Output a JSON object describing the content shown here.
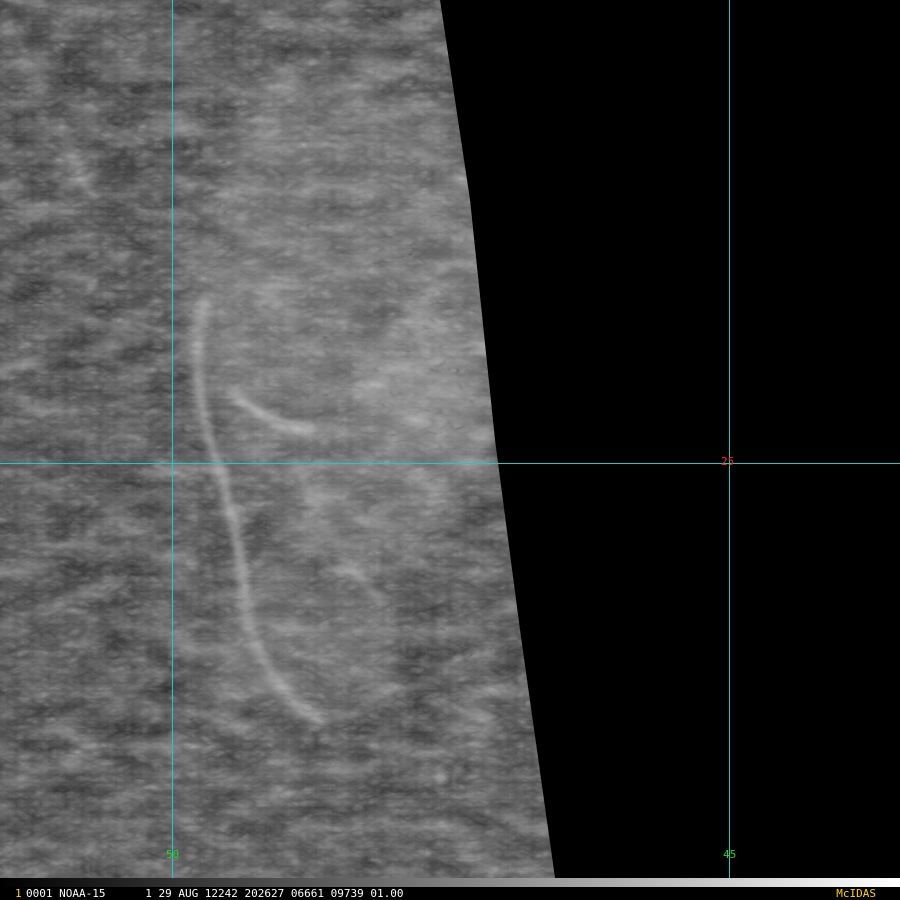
{
  "colors": {
    "grid_line": "#20c8c8",
    "longitude_label": "#2fd02f",
    "latitude_label": "#ff2b2b",
    "status_text": "#ffffff",
    "frame_number": "#ffd400",
    "software_label": "#ffd400"
  },
  "grid": {
    "longitudes": [
      {
        "label": "50"
      },
      {
        "label": "45"
      }
    ],
    "latitudes": [
      {
        "label": "25"
      }
    ]
  },
  "status_bar": {
    "frame_number": "1",
    "text": "0001 NOAA-15      1 29 AUG 12242 202627 06661 09739 01.00",
    "software": "McIDAS"
  }
}
